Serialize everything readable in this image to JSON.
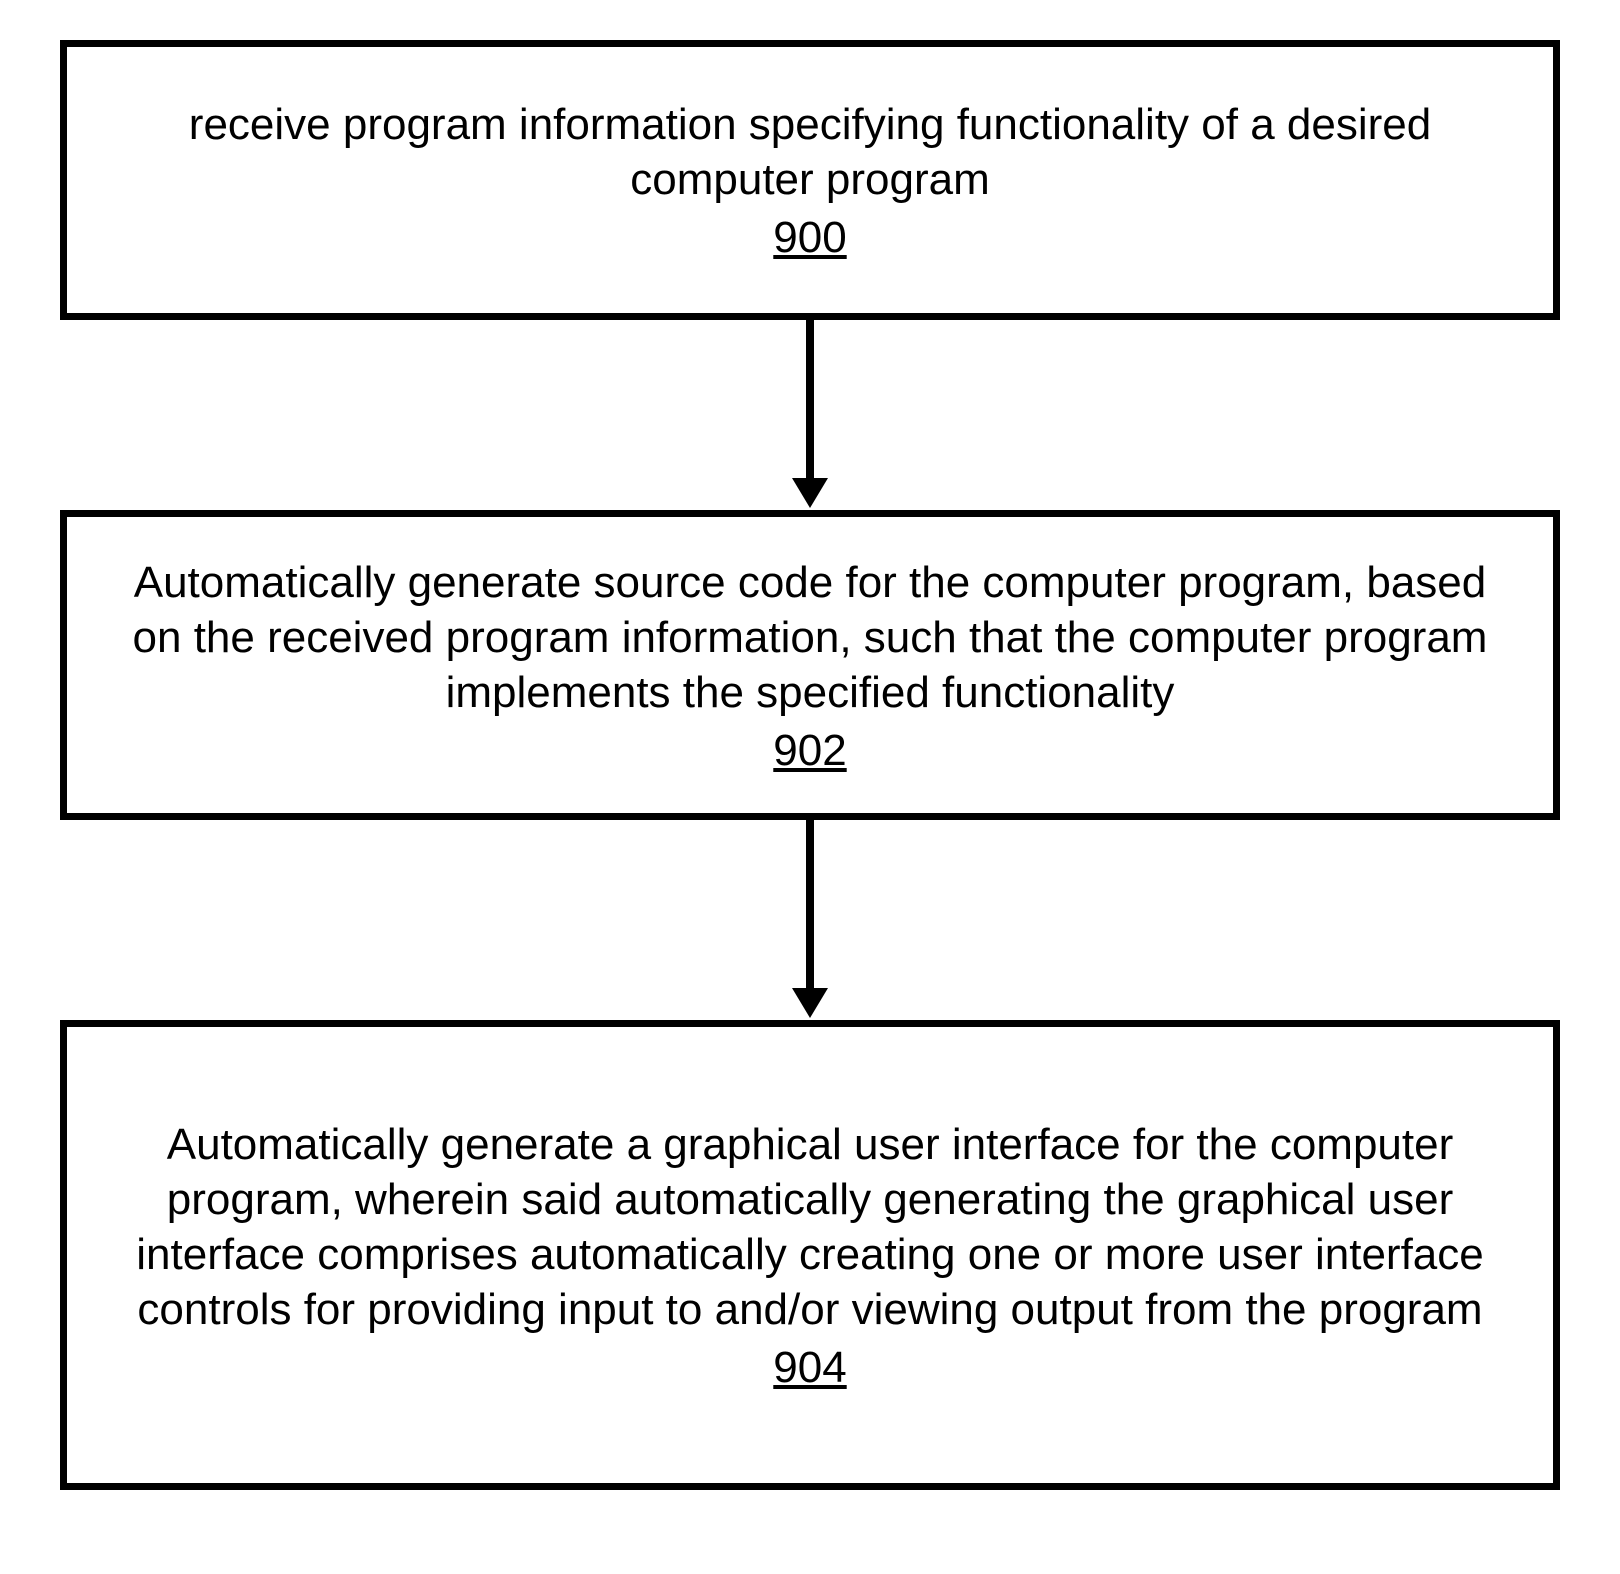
{
  "diagram": {
    "boxes": [
      {
        "text": "receive program information specifying functionality of a desired computer program",
        "ref": "900"
      },
      {
        "text": "Automatically generate source code for the computer program, based on the received program information, such that the computer program implements the specified functionality",
        "ref": "902"
      },
      {
        "text": "Automatically generate a graphical user interface for the computer program, wherein said automatically generating the graphical user interface comprises automatically creating one or more user interface controls for providing input to and/or viewing output from the program",
        "ref": "904"
      }
    ]
  }
}
